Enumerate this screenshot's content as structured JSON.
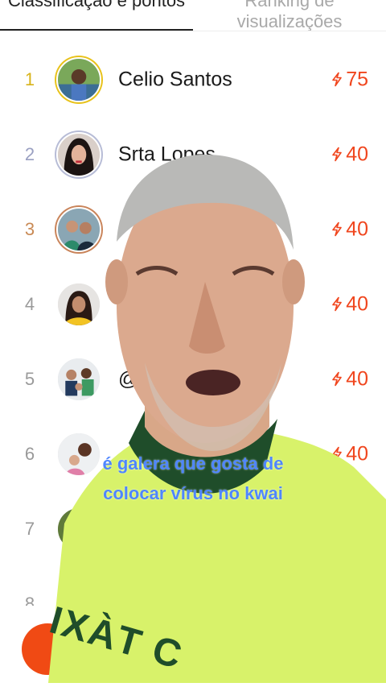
{
  "tabs": {
    "left_label": "Classificação e pontos",
    "right_label": "Ranking de visualizações"
  },
  "leaderboard": [
    {
      "rank": "1",
      "name": "Celio Santos",
      "points": "75",
      "rank_color": "#d8b31a",
      "ring": "#e8c21a"
    },
    {
      "rank": "2",
      "name": "Srta Lopes",
      "points": "40",
      "rank_color": "#9aa0c2",
      "ring": "#b7bcd6"
    },
    {
      "rank": "3",
      "name": "",
      "points": "40",
      "rank_color": "#c98a55",
      "ring": "#c9845a"
    },
    {
      "rank": "4",
      "name": "",
      "points": "40",
      "rank_color": "#9a9a9a",
      "ring": "#ffffff"
    },
    {
      "rank": "5",
      "name": "@",
      "points": "40",
      "rank_color": "#9a9a9a",
      "ring": "#ffffff"
    },
    {
      "rank": "6",
      "name": "",
      "points": "40",
      "rank_color": "#9a9a9a",
      "ring": "#ffffff"
    },
    {
      "rank": "7",
      "name": "",
      "points": "",
      "rank_color": "#9a9a9a",
      "ring": "#ffffff"
    },
    {
      "rank": "8",
      "name": "",
      "points": "",
      "rank_color": "#9a9a9a",
      "ring": "#ffffff"
    }
  ],
  "video_overlay": {
    "caption_line1": "é galera que gosta de",
    "caption_line2": "colocar vírus no kwai",
    "shirt_text": "IXÀT C"
  },
  "colors": {
    "points_accent": "#f0461e",
    "caption": "#4f86ff",
    "fab": "#f04a14"
  },
  "icons": {
    "points": "lightning-bolt-icon"
  }
}
